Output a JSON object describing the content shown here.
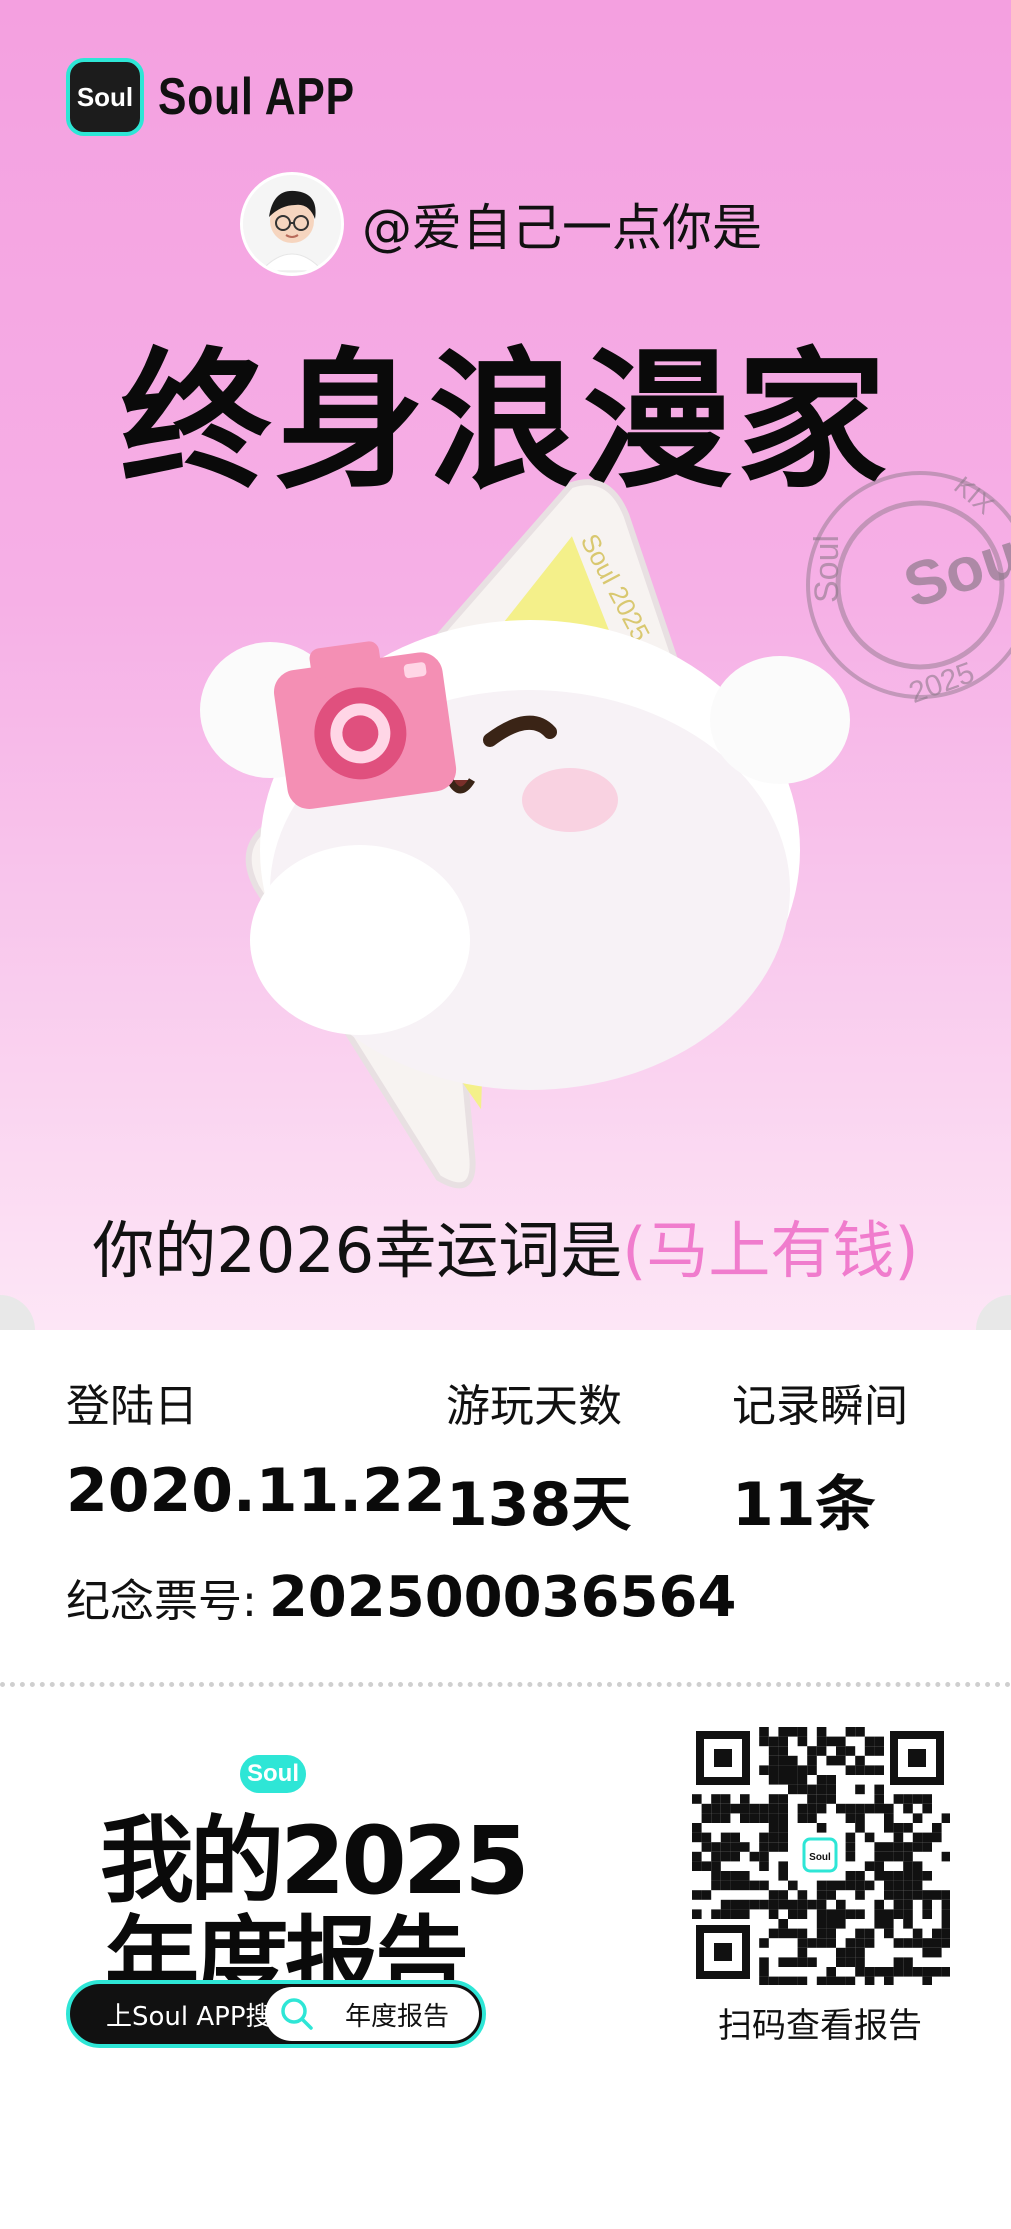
{
  "brand": {
    "logo_text": "Soul",
    "app_name": "Soul APP"
  },
  "user": {
    "text": "@爱自己一点你是"
  },
  "title": "终身浪漫家",
  "stamp": {
    "center_text": "Soul",
    "ring_top": "KIX",
    "ring_left": "Soul",
    "ring_bottom": "2025"
  },
  "card_ribbon_text": "Soul 2025",
  "lucky": {
    "prefix": "你的2026幸运词是",
    "word": "(马上有钱)"
  },
  "stats": [
    {
      "label": "登陆日",
      "value": "2020.11.22"
    },
    {
      "label": "游玩天数",
      "value": "138天"
    },
    {
      "label": "记录瞬间",
      "value": "11条"
    }
  ],
  "ticket": {
    "label": "纪念票号:",
    "value": "202500036564"
  },
  "report": {
    "badge": "Soul",
    "line1": "我的2025",
    "line2": "年度报告"
  },
  "search_pill": {
    "left_text": "上Soul APP搜",
    "right_text": "年度报告"
  },
  "qr": {
    "center_text": "Soul",
    "caption": "扫码查看报告"
  },
  "colors": {
    "accent_teal": "#2ee6d6",
    "pink": "#f07ccd",
    "bg_pink": "#f4a0e0"
  }
}
